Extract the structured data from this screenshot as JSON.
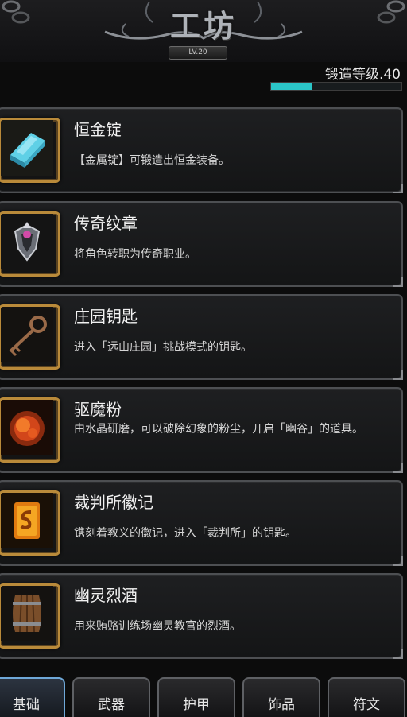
{
  "header": {
    "title": "工坊",
    "level_badge": "LV.20"
  },
  "forge": {
    "label": "锻造等级.40",
    "progress": 0.32,
    "fill_color": "#2bc6c8"
  },
  "items": [
    {
      "name": "恒金锭",
      "desc": "【金属锭】可锻造出恒金装备。",
      "icon": "platinum-ingot-icon"
    },
    {
      "name": "传奇纹章",
      "desc": "将角色转职为传奇职业。",
      "icon": "legend-crest-icon"
    },
    {
      "name": "庄园钥匙",
      "desc": "进入「远山庄园」挑战模式的钥匙。",
      "icon": "manor-key-icon"
    },
    {
      "name": "驱魔粉",
      "desc": "由水晶研磨，可以破除幻象的粉尘，开启「幽谷」的道具。",
      "icon": "exorcism-powder-icon"
    },
    {
      "name": "裁判所徽记",
      "desc": "镌刻着教义的徽记，进入「裁判所」的钥匙。",
      "icon": "tribunal-emblem-icon"
    },
    {
      "name": "幽灵烈酒",
      "desc": "用来贿赂训练场幽灵教官的烈酒。",
      "icon": "ghost-liquor-barrel-icon"
    }
  ],
  "tabs": [
    "基础",
    "武器",
    "护甲",
    "饰品",
    "符文"
  ],
  "colors": {
    "frame_gold": "#b98a3a",
    "tab_active_border": "#6fa8d8"
  }
}
